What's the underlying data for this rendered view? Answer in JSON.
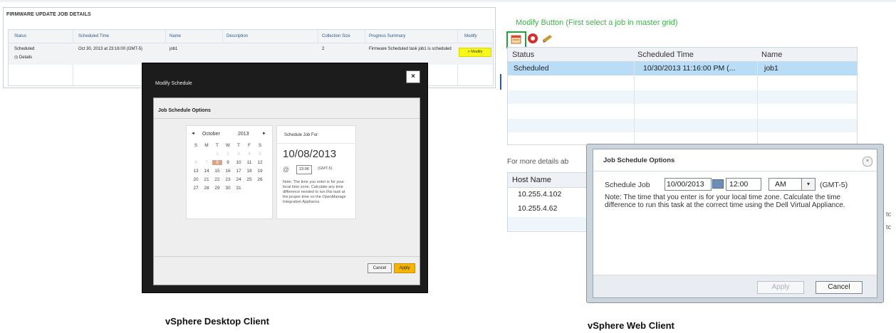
{
  "desktop": {
    "panel_title": "FIRMWARE UPDATE JOB DETAILS",
    "columns": [
      "Status",
      "Scheduled Time",
      "Name",
      "Description",
      "Collection Size",
      "Progress Summary",
      "Modify"
    ],
    "row": {
      "status": "Scheduled",
      "details_link": "Details",
      "scheduled_time": "Oct 30, 2013 at 23:16:00 (GMT-5)",
      "name": "job1",
      "description": "",
      "collection_size": "2",
      "progress_summary": "Firmware Scheduled task job1 is scheduled",
      "modify_label": "> Modify"
    },
    "dialog": {
      "title": "Modify Schedule",
      "close_label": "×",
      "section": "Job Schedule Options",
      "calendar": {
        "prev": "◄",
        "next": "►",
        "month": "October",
        "year": "2013",
        "weekdays": [
          "S",
          "M",
          "T",
          "W",
          "T",
          "F",
          "S"
        ],
        "weeks": [
          [
            "",
            "",
            "1",
            "2",
            "3",
            "4",
            "5"
          ],
          [
            "6",
            "7",
            "8",
            "9",
            "10",
            "11",
            "12"
          ],
          [
            "13",
            "14",
            "15",
            "16",
            "17",
            "18",
            "19"
          ],
          [
            "20",
            "21",
            "22",
            "23",
            "24",
            "25",
            "26"
          ],
          [
            "27",
            "28",
            "29",
            "30",
            "31",
            "",
            ""
          ]
        ],
        "selected_day": "8"
      },
      "schedule_label": "Schedule Job For:",
      "schedule_date": "10/08/2013",
      "at_symbol": "@",
      "time_value": "23:06",
      "timezone": "(GMT-5)",
      "note": "Note: The time you enter is for your local time zone. Calculate any time difference needed to run this task at the proper time on the OpenManage Integration Appliance.",
      "cancel_label": "Cancel",
      "apply_label": "Apply"
    },
    "caption": "vSphere Desktop Client"
  },
  "web": {
    "modify_note": "Modify Button  (First select a job in master grid)",
    "grid": {
      "columns": [
        "Status",
        "Scheduled Time",
        "Name"
      ],
      "row": {
        "status": "Scheduled",
        "scheduled_time": "10/30/2013 11:16:00 PM (...",
        "name": "job1"
      }
    },
    "more_details": "For more details ab",
    "hosts": {
      "header": "Host Name",
      "rows": [
        "10.255.4.102",
        "10.255.4.62"
      ]
    },
    "dialog": {
      "title": "Job Schedule Options",
      "close_label": "×",
      "schedule_label": "Schedule Job",
      "date_value": "10/00/2013",
      "time_value": "12:00",
      "ampm_value": "AM",
      "dropdown_arrow": "▾",
      "timezone": "(GMT-5)",
      "note": "Note: The time that you enter is for your local time zone. Calculate the time difference to run this task at the correct time using the Dell Virtual Appliance.",
      "apply_label": "Apply",
      "cancel_label": "Cancel"
    },
    "caption": "vSphere Web Client"
  },
  "colors": {
    "highlight_green": "#3db64a",
    "selected_row": "#b9dcf7",
    "modify_yellow": "#f7f71a",
    "apply_orange": "#f4b400"
  }
}
